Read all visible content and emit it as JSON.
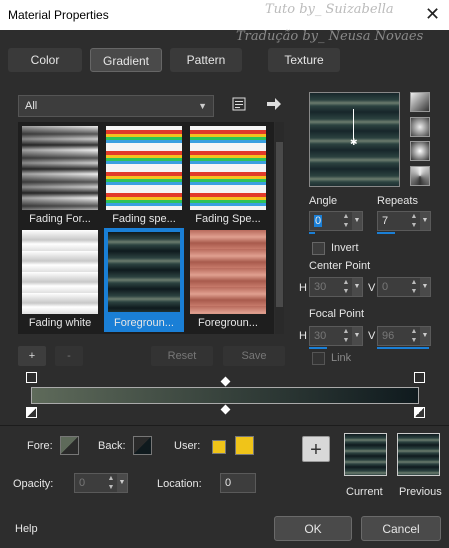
{
  "window": {
    "title": "Material Properties",
    "watermark_1": "Tuto by_ Suizabella",
    "watermark_2": "Tradução by_ Neusa Novaes",
    "close_glyph": "✕"
  },
  "tabs": [
    {
      "label": "Color",
      "active": false
    },
    {
      "label": "Gradient",
      "active": true
    },
    {
      "label": "Pattern",
      "active": false
    },
    {
      "label": "Texture",
      "active": false
    }
  ],
  "category_select": {
    "value": "All"
  },
  "gallery": {
    "items": [
      {
        "label": "Fading For...",
        "selected": false
      },
      {
        "label": "Fading spe...",
        "selected": false
      },
      {
        "label": "Fading Spe...",
        "selected": false
      },
      {
        "label": "Fading white",
        "selected": false
      },
      {
        "label": "Foregroun...",
        "selected": true
      },
      {
        "label": "Foregroun...",
        "selected": false
      }
    ]
  },
  "gradient_controls": {
    "angle_label": "Angle",
    "angle_value": "0",
    "repeats_label": "Repeats",
    "repeats_value": "7",
    "invert_label": "Invert",
    "center_point_label": "Center Point",
    "center_h_label": "H",
    "center_h_value": "30",
    "center_v_label": "V",
    "center_v_value": "0",
    "focal_point_label": "Focal Point",
    "focal_h_label": "H",
    "focal_h_value": "30",
    "focal_v_label": "V",
    "focal_v_value": "96",
    "link_label": "Link"
  },
  "editor_buttons": {
    "add": "+",
    "remove": "-",
    "reset": "Reset",
    "save": "Save"
  },
  "stops": {
    "fore_label": "Fore:",
    "back_label": "Back:",
    "user_label": "User:",
    "user_color": "#f0c419",
    "opacity_label": "Opacity:",
    "opacity_value": "0",
    "location_label": "Location:",
    "location_value": "0"
  },
  "swatches": {
    "add_glyph": "+",
    "current_label": "Current",
    "previous_label": "Previous"
  },
  "footer": {
    "help": "Help",
    "ok": "OK",
    "cancel": "Cancel"
  },
  "colors": {
    "accent": "#1a7fd6",
    "background": "#2d2d2d",
    "gradient_start": "#5e6a5a",
    "gradient_end": "#0f1a1e"
  },
  "icons": {
    "library": "library-icon",
    "arrow": "arrow-right-icon"
  }
}
